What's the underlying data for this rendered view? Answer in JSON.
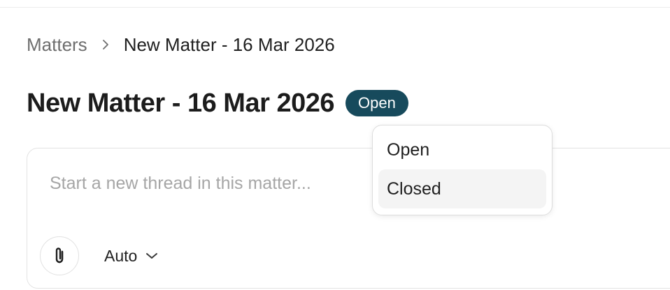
{
  "breadcrumb": {
    "root": "Matters",
    "current": "New Matter - 16 Mar 2026"
  },
  "page": {
    "title": "New Matter - 16 Mar 2026",
    "status": "Open",
    "status_color": "#174a5c"
  },
  "composer": {
    "placeholder": "Start a new thread in this matter...",
    "value": "",
    "attach_icon": "paperclip-icon",
    "model_label": "Auto",
    "model_icon": "chevron-down-icon"
  },
  "status_menu": {
    "items": [
      {
        "label": "Open"
      },
      {
        "label": "Closed"
      }
    ]
  }
}
